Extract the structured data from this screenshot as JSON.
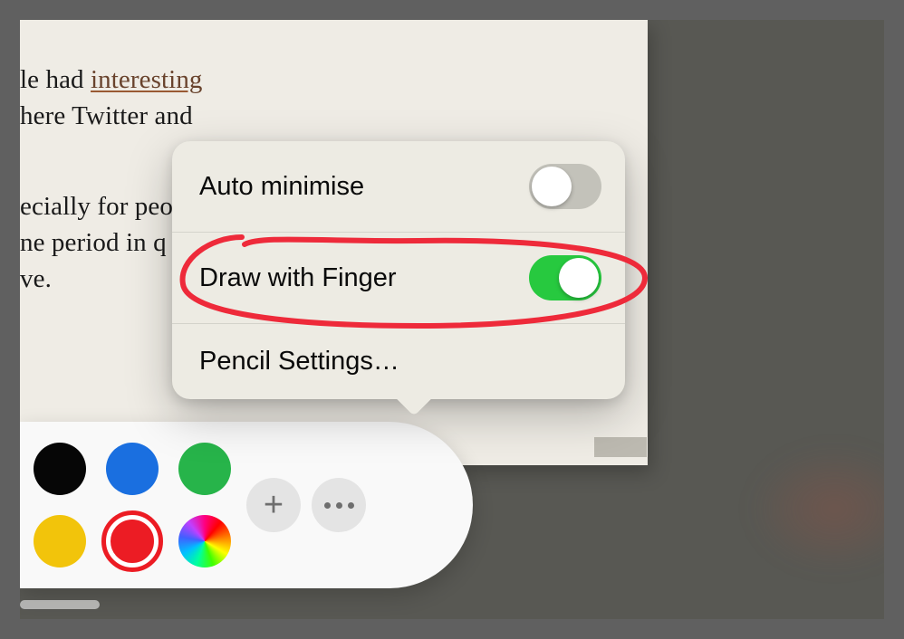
{
  "document": {
    "line1_a": "le had ",
    "line1_link": "interesting",
    "line2": "here Twitter and",
    "line3": "ecially for peo",
    "line4": "ne period in q",
    "line5": "ve."
  },
  "popover": {
    "auto_minimise_label": "Auto minimise",
    "auto_minimise_enabled": false,
    "draw_with_finger_label": "Draw with Finger",
    "draw_with_finger_enabled": true,
    "pencil_settings_label": "Pencil Settings…"
  },
  "toolbar": {
    "colors": [
      "black",
      "blue",
      "green",
      "yellow",
      "red",
      "rainbow"
    ],
    "selected_color": "red"
  }
}
